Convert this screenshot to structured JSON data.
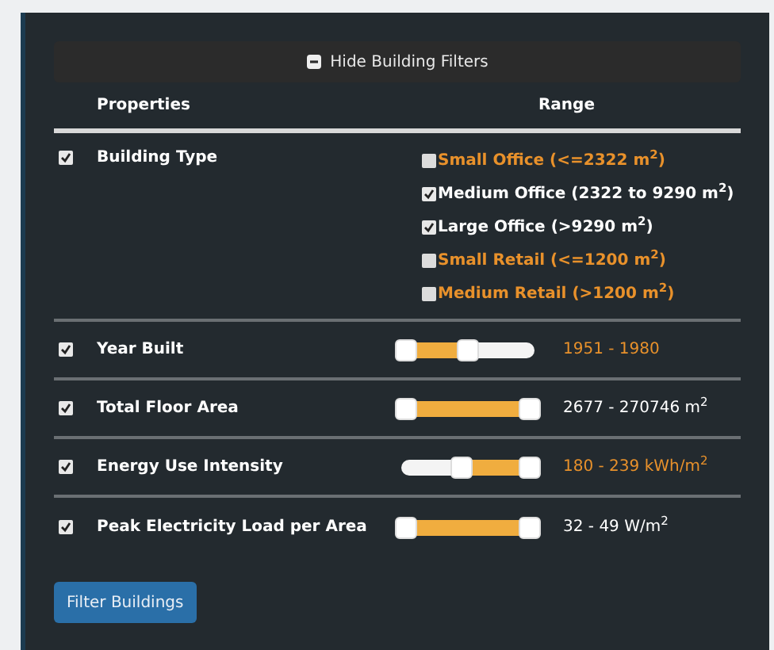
{
  "toggle_button": {
    "label": "Hide Building Filters"
  },
  "columns": [
    "Properties",
    "Range"
  ],
  "properties": [
    {
      "kind": "options",
      "name": "Building Type",
      "checked": true,
      "options": [
        {
          "label": "Small Office (<=2322 m$^{2}$)",
          "checked": false
        },
        {
          "label": "Medium Office (2322 to 9290 m$^{2}$)",
          "checked": true
        },
        {
          "label": "Large Office (>9290 m$^{2}$)",
          "checked": true
        },
        {
          "label": "Small Retail (<=1200 m$^{2}$)",
          "checked": false
        },
        {
          "label": "Medium Retail (>1200 m$^{2}$)",
          "checked": false
        }
      ]
    },
    {
      "kind": "range",
      "name": "Year Built",
      "checked": true,
      "modified": true,
      "thumbs": [
        {
          "level": 0
        },
        {
          "level": 0.5
        }
      ],
      "reading": "1951 - 1980"
    },
    {
      "kind": "range",
      "name": "Total Floor Area",
      "checked": true,
      "modified": false,
      "thumbs": [
        {
          "level": 0
        },
        {
          "level": 1
        }
      ],
      "reading": "2677 - 270746 m$^{2}$"
    },
    {
      "kind": "range",
      "name": "Energy Use Intensity",
      "checked": true,
      "modified": true,
      "thumbs": [
        {
          "level": 0.45
        },
        {
          "level": 1
        }
      ],
      "reading": "180 - 239 kWh/m$^{2}$"
    },
    {
      "kind": "range",
      "name": "Peak Electricity Load per Area",
      "checked": true,
      "modified": false,
      "thumbs": [
        {
          "level": 0
        },
        {
          "level": 1
        }
      ],
      "reading": "32 - 49 W/m$^{2}$"
    }
  ],
  "submit_button": {
    "label": "Filter Buildings"
  }
}
